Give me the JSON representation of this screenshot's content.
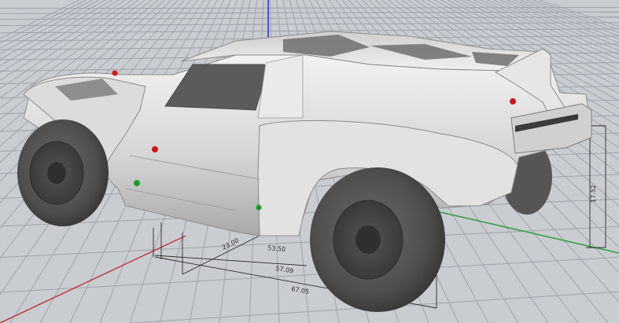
{
  "viewport": {
    "name": "perspective-viewport",
    "background_color": "#c9ccd1",
    "grid_color": "#9fa4ab",
    "x_axis_color": "#c0393b",
    "y_axis_color": "#2e9e3a",
    "z_axis_color": "#2c2cc9"
  },
  "model": {
    "name": "short-course-truck-body",
    "body_color": "#d9d9d9",
    "tire_color": "#555555",
    "marker_colors": {
      "red": "#cc1a1a",
      "green": "#1f9a2a"
    }
  },
  "dimensions": {
    "d1": "23.00",
    "d2": "53.50",
    "d3": "57.09",
    "d4": "67.05",
    "height": "17.52"
  }
}
